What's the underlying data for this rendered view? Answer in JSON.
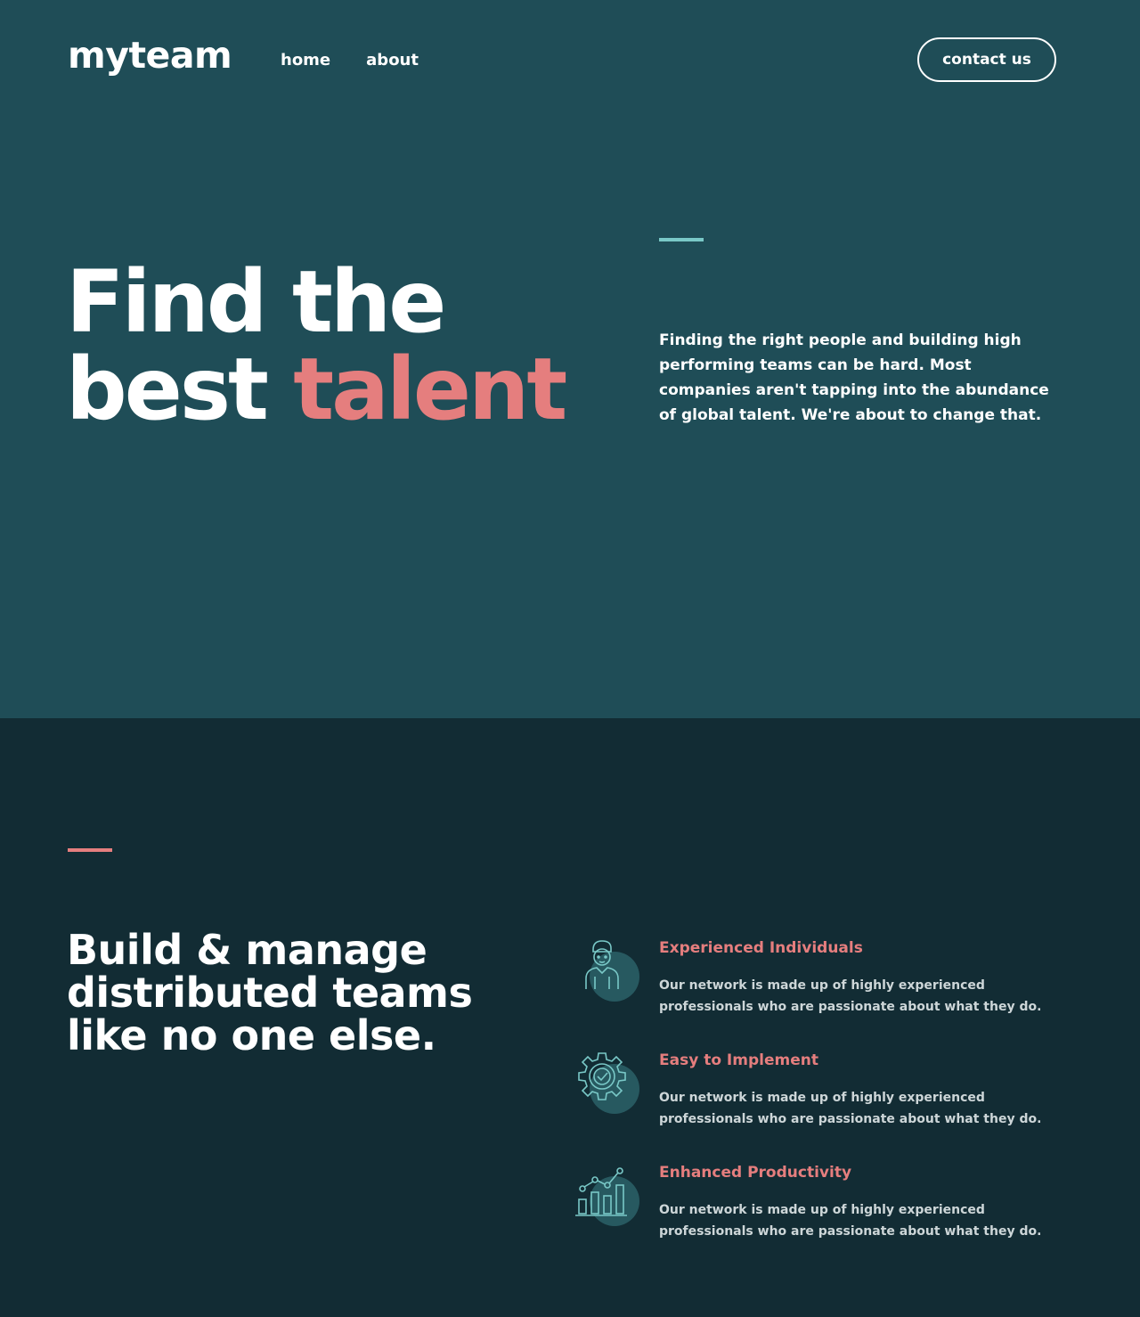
{
  "header": {
    "logo": "myteam",
    "nav": [
      {
        "label": "home"
      },
      {
        "label": "about"
      }
    ],
    "contact_label": "contact us"
  },
  "hero": {
    "title_line1": "Find the",
    "title_line2_plain": "best ",
    "title_line2_accent": "talent",
    "description": "Finding the right people and building high performing teams can be hard. Most companies aren't tapping into the abundance of global talent. We're about to change that."
  },
  "features": {
    "heading": "Build & manage distributed teams like no one else.",
    "items": [
      {
        "icon": "person-icon",
        "title": "Experienced Individuals",
        "text": "Our network is made up of highly experienced professionals who are passionate about what they do."
      },
      {
        "icon": "gear-check-icon",
        "title": "Easy to Implement",
        "text": "Our network is made up of highly experienced professionals who are passionate about what they do."
      },
      {
        "icon": "growth-chart-icon",
        "title": "Enhanced Productivity",
        "text": "Our network is made up of highly experienced professionals who are passionate about what they do."
      }
    ]
  },
  "colors": {
    "hero_bg": "#1f4d57",
    "features_bg": "#122c34",
    "accent_coral": "#e57e7e",
    "accent_teal": "#79c8c7"
  }
}
